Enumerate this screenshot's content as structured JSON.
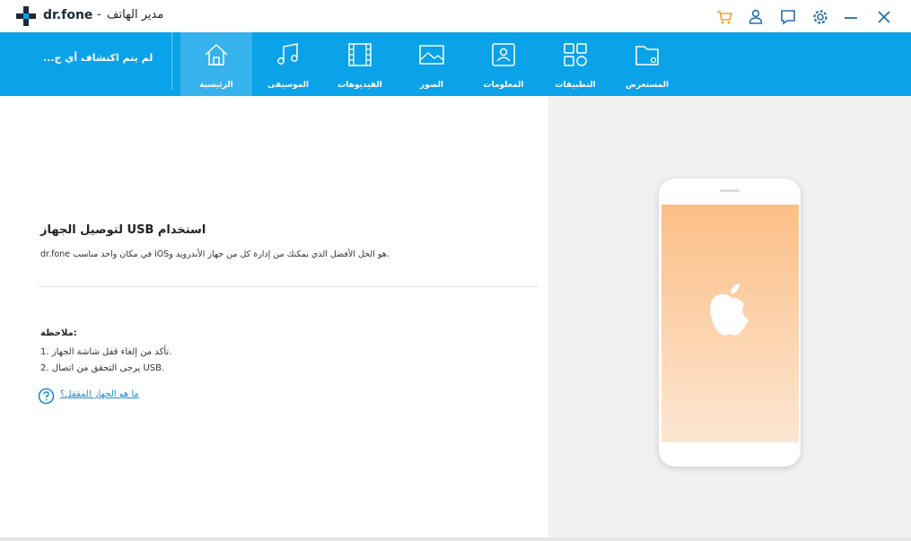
{
  "window": {
    "brand": "dr.fone",
    "separator": "-",
    "app_name": "مدير الهاتف",
    "accent_color": "#0aa2e8",
    "cart_color": "#f0a030"
  },
  "titlebar_icons": [
    "cart-icon",
    "user-icon",
    "feedback-icon",
    "settings-icon",
    "minimize-icon",
    "close-icon"
  ],
  "nav": {
    "device_status": "لم يتم اكتشاف أي ج...",
    "tabs": [
      {
        "label": "الرئيسية",
        "icon": "home-icon",
        "active": true
      },
      {
        "label": "الموسيقى",
        "icon": "music-icon",
        "active": false
      },
      {
        "label": "الفيديوهات",
        "icon": "video-icon",
        "active": false
      },
      {
        "label": "الصور",
        "icon": "photo-icon",
        "active": false
      },
      {
        "label": "المعلومات",
        "icon": "contacts-icon",
        "active": false
      },
      {
        "label": "التطبيقات",
        "icon": "apps-icon",
        "active": false
      },
      {
        "label": "المستعرض",
        "icon": "explorer-icon",
        "active": false
      }
    ]
  },
  "main": {
    "heading": "لتوصيل الجهاز USB استخدام",
    "description_part1": "dr.fone",
    "description_part2": "في مكان واحد مناسب iOSهو الحل الأفضل الذي يمكنك من إدارة كل من جهاز الأندرويد و.",
    "note_title": "ملاحظة:",
    "note_lines": [
      "1. تأكد من إلغاء قفل شاشة الجهاز.",
      "2. يرجى التحقق من اتصال USB."
    ],
    "help_link": "ما هو الجهاز المقفل؟"
  },
  "illustration": {
    "device": "phone",
    "logo_icon": "apple-icon"
  }
}
